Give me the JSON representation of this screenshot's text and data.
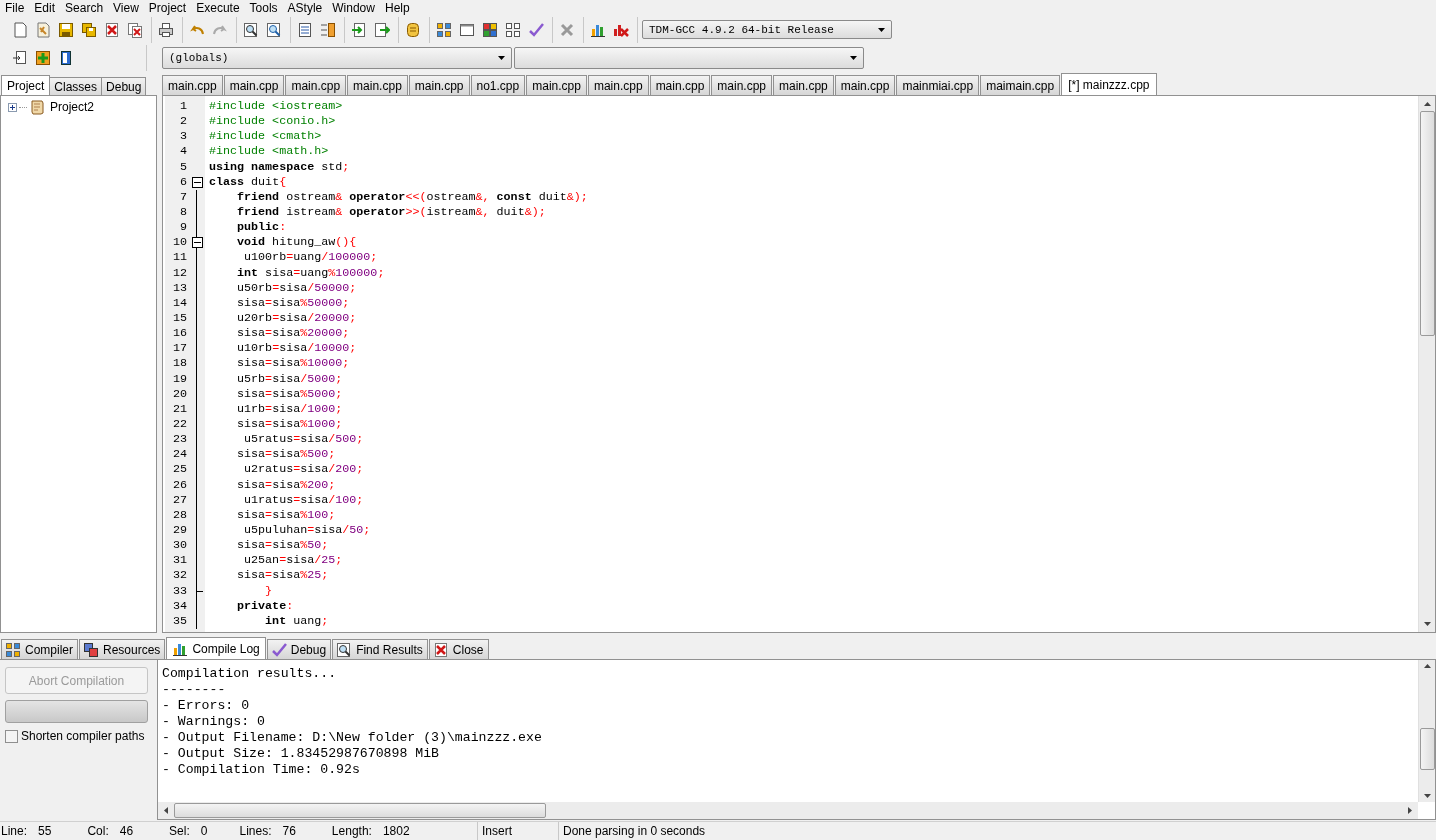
{
  "menu": [
    "File",
    "Edit",
    "Search",
    "View",
    "Project",
    "Execute",
    "Tools",
    "AStyle",
    "Window",
    "Help"
  ],
  "toolbar": {
    "compiler": "TDM-GCC 4.9.2 64-bit Release"
  },
  "scope_bar": {
    "class": "(globals)"
  },
  "side_panel": {
    "tabs": [
      {
        "label": "Project",
        "selected": true
      },
      {
        "label": "Classes",
        "selected": false
      },
      {
        "label": "Debug",
        "selected": false
      }
    ],
    "tree": [
      {
        "label": "Project2",
        "expanded": false
      }
    ]
  },
  "editor": {
    "tabs": [
      {
        "label": "main.cpp",
        "selected": false
      },
      {
        "label": "main.cpp",
        "selected": false
      },
      {
        "label": "main.cpp",
        "selected": false
      },
      {
        "label": "main.cpp",
        "selected": false
      },
      {
        "label": "main.cpp",
        "selected": false
      },
      {
        "label": "no1.cpp",
        "selected": false
      },
      {
        "label": "main.cpp",
        "selected": false
      },
      {
        "label": "main.cpp",
        "selected": false
      },
      {
        "label": "main.cpp",
        "selected": false
      },
      {
        "label": "main.cpp",
        "selected": false
      },
      {
        "label": "main.cpp",
        "selected": false
      },
      {
        "label": "main.cpp",
        "selected": false
      },
      {
        "label": "mainmiai.cpp",
        "selected": false
      },
      {
        "label": "maimain.cpp",
        "selected": false
      },
      {
        "label": "[*] mainzzz.cpp",
        "selected": true
      }
    ],
    "lines": [
      {
        "number": "1",
        "kind": "plain",
        "tokens": [
          {
            "kind": "preprocessor",
            "t": "#include <iostream>"
          }
        ]
      },
      {
        "number": "2",
        "kind": "plain",
        "tokens": [
          {
            "kind": "preprocessor",
            "t": "#include <conio.h>"
          }
        ]
      },
      {
        "number": "3",
        "kind": "plain",
        "tokens": [
          {
            "kind": "preprocessor",
            "t": "#include <cmath>"
          }
        ]
      },
      {
        "number": "4",
        "kind": "plain",
        "tokens": [
          {
            "kind": "preprocessor",
            "t": "#include <math.h>"
          }
        ]
      },
      {
        "number": "5",
        "kind": "plain",
        "tokens": [
          {
            "kind": "keyword",
            "t": "using namespace"
          },
          {
            "kind": "identifier",
            "t": " std"
          },
          {
            "kind": "symbol",
            "t": ";"
          }
        ]
      },
      {
        "number": "6",
        "kind": "fold-start",
        "tokens": [
          {
            "kind": "keyword",
            "t": "class"
          },
          {
            "kind": "identifier",
            "t": " duit"
          },
          {
            "kind": "symbol",
            "t": "{"
          }
        ]
      },
      {
        "number": "7",
        "kind": "plain",
        "tokens": [
          {
            "kind": "keyword",
            "t": "    friend"
          },
          {
            "kind": "identifier",
            "t": " ostream"
          },
          {
            "kind": "symbol",
            "t": "&"
          },
          {
            "kind": "keyword",
            "t": " operator"
          },
          {
            "kind": "symbol",
            "t": "<<("
          },
          {
            "kind": "identifier",
            "t": "ostream"
          },
          {
            "kind": "symbol",
            "t": "&,"
          },
          {
            "kind": "keyword",
            "t": " const"
          },
          {
            "kind": "identifier",
            "t": " duit"
          },
          {
            "kind": "symbol",
            "t": "&);"
          }
        ]
      },
      {
        "number": "8",
        "kind": "plain",
        "tokens": [
          {
            "kind": "keyword",
            "t": "    friend"
          },
          {
            "kind": "identifier",
            "t": " istream"
          },
          {
            "kind": "symbol",
            "t": "&"
          },
          {
            "kind": "keyword",
            "t": " operator"
          },
          {
            "kind": "symbol",
            "t": ">>("
          },
          {
            "kind": "identifier",
            "t": "istream"
          },
          {
            "kind": "symbol",
            "t": "&,"
          },
          {
            "kind": "identifier",
            "t": " duit"
          },
          {
            "kind": "symbol",
            "t": "&);"
          }
        ]
      },
      {
        "number": "9",
        "kind": "plain",
        "tokens": [
          {
            "kind": "keyword",
            "t": "    public"
          },
          {
            "kind": "symbol",
            "t": ":"
          }
        ]
      },
      {
        "number": "10",
        "kind": "fold-start",
        "tokens": [
          {
            "kind": "keyword",
            "t": "    void"
          },
          {
            "kind": "identifier",
            "t": " hitung_aw"
          },
          {
            "kind": "symbol",
            "t": "(){"
          }
        ]
      },
      {
        "number": "11",
        "kind": "plain",
        "tokens": [
          {
            "kind": "identifier",
            "t": "     u100rb"
          },
          {
            "kind": "symbol",
            "t": "="
          },
          {
            "kind": "identifier",
            "t": "uang"
          },
          {
            "kind": "symbol",
            "t": "/"
          },
          {
            "kind": "number",
            "t": "100000"
          },
          {
            "kind": "symbol",
            "t": ";"
          }
        ]
      },
      {
        "number": "12",
        "kind": "plain",
        "tokens": [
          {
            "kind": "keyword",
            "t": "    int"
          },
          {
            "kind": "identifier",
            "t": " sisa"
          },
          {
            "kind": "symbol",
            "t": "="
          },
          {
            "kind": "identifier",
            "t": "uang"
          },
          {
            "kind": "symbol",
            "t": "%"
          },
          {
            "kind": "number",
            "t": "100000"
          },
          {
            "kind": "symbol",
            "t": ";"
          }
        ]
      },
      {
        "number": "13",
        "kind": "plain",
        "tokens": [
          {
            "kind": "identifier",
            "t": "    u50rb"
          },
          {
            "kind": "symbol",
            "t": "="
          },
          {
            "kind": "identifier",
            "t": "sisa"
          },
          {
            "kind": "symbol",
            "t": "/"
          },
          {
            "kind": "number",
            "t": "50000"
          },
          {
            "kind": "symbol",
            "t": ";"
          }
        ]
      },
      {
        "number": "14",
        "kind": "plain",
        "tokens": [
          {
            "kind": "identifier",
            "t": "    sisa"
          },
          {
            "kind": "symbol",
            "t": "="
          },
          {
            "kind": "identifier",
            "t": "sisa"
          },
          {
            "kind": "symbol",
            "t": "%"
          },
          {
            "kind": "number",
            "t": "50000"
          },
          {
            "kind": "symbol",
            "t": ";"
          }
        ]
      },
      {
        "number": "15",
        "kind": "plain",
        "tokens": [
          {
            "kind": "identifier",
            "t": "    u20rb"
          },
          {
            "kind": "symbol",
            "t": "="
          },
          {
            "kind": "identifier",
            "t": "sisa"
          },
          {
            "kind": "symbol",
            "t": "/"
          },
          {
            "kind": "number",
            "t": "20000"
          },
          {
            "kind": "symbol",
            "t": ";"
          }
        ]
      },
      {
        "number": "16",
        "kind": "plain",
        "tokens": [
          {
            "kind": "identifier",
            "t": "    sisa"
          },
          {
            "kind": "symbol",
            "t": "="
          },
          {
            "kind": "identifier",
            "t": "sisa"
          },
          {
            "kind": "symbol",
            "t": "%"
          },
          {
            "kind": "number",
            "t": "20000"
          },
          {
            "kind": "symbol",
            "t": ";"
          }
        ]
      },
      {
        "number": "17",
        "kind": "plain",
        "tokens": [
          {
            "kind": "identifier",
            "t": "    u10rb"
          },
          {
            "kind": "symbol",
            "t": "="
          },
          {
            "kind": "identifier",
            "t": "sisa"
          },
          {
            "kind": "symbol",
            "t": "/"
          },
          {
            "kind": "number",
            "t": "10000"
          },
          {
            "kind": "symbol",
            "t": ";"
          }
        ]
      },
      {
        "number": "18",
        "kind": "plain",
        "tokens": [
          {
            "kind": "identifier",
            "t": "    sisa"
          },
          {
            "kind": "symbol",
            "t": "="
          },
          {
            "kind": "identifier",
            "t": "sisa"
          },
          {
            "kind": "symbol",
            "t": "%"
          },
          {
            "kind": "number",
            "t": "10000"
          },
          {
            "kind": "symbol",
            "t": ";"
          }
        ]
      },
      {
        "number": "19",
        "kind": "plain",
        "tokens": [
          {
            "kind": "identifier",
            "t": "    u5rb"
          },
          {
            "kind": "symbol",
            "t": "="
          },
          {
            "kind": "identifier",
            "t": "sisa"
          },
          {
            "kind": "symbol",
            "t": "/"
          },
          {
            "kind": "number",
            "t": "5000"
          },
          {
            "kind": "symbol",
            "t": ";"
          }
        ]
      },
      {
        "number": "20",
        "kind": "plain",
        "tokens": [
          {
            "kind": "identifier",
            "t": "    sisa"
          },
          {
            "kind": "symbol",
            "t": "="
          },
          {
            "kind": "identifier",
            "t": "sisa"
          },
          {
            "kind": "symbol",
            "t": "%"
          },
          {
            "kind": "number",
            "t": "5000"
          },
          {
            "kind": "symbol",
            "t": ";"
          }
        ]
      },
      {
        "number": "21",
        "kind": "plain",
        "tokens": [
          {
            "kind": "identifier",
            "t": "    u1rb"
          },
          {
            "kind": "symbol",
            "t": "="
          },
          {
            "kind": "identifier",
            "t": "sisa"
          },
          {
            "kind": "symbol",
            "t": "/"
          },
          {
            "kind": "number",
            "t": "1000"
          },
          {
            "kind": "symbol",
            "t": ";"
          }
        ]
      },
      {
        "number": "22",
        "kind": "plain",
        "tokens": [
          {
            "kind": "identifier",
            "t": "    sisa"
          },
          {
            "kind": "symbol",
            "t": "="
          },
          {
            "kind": "identifier",
            "t": "sisa"
          },
          {
            "kind": "symbol",
            "t": "%"
          },
          {
            "kind": "number",
            "t": "1000"
          },
          {
            "kind": "symbol",
            "t": ";"
          }
        ]
      },
      {
        "number": "23",
        "kind": "plain",
        "tokens": [
          {
            "kind": "identifier",
            "t": "     u5ratus"
          },
          {
            "kind": "symbol",
            "t": "="
          },
          {
            "kind": "identifier",
            "t": "sisa"
          },
          {
            "kind": "symbol",
            "t": "/"
          },
          {
            "kind": "number",
            "t": "500"
          },
          {
            "kind": "symbol",
            "t": ";"
          }
        ]
      },
      {
        "number": "24",
        "kind": "plain",
        "tokens": [
          {
            "kind": "identifier",
            "t": "    sisa"
          },
          {
            "kind": "symbol",
            "t": "="
          },
          {
            "kind": "identifier",
            "t": "sisa"
          },
          {
            "kind": "symbol",
            "t": "%"
          },
          {
            "kind": "number",
            "t": "500"
          },
          {
            "kind": "symbol",
            "t": ";"
          }
        ]
      },
      {
        "number": "25",
        "kind": "plain",
        "tokens": [
          {
            "kind": "identifier",
            "t": "     u2ratus"
          },
          {
            "kind": "symbol",
            "t": "="
          },
          {
            "kind": "identifier",
            "t": "sisa"
          },
          {
            "kind": "symbol",
            "t": "/"
          },
          {
            "kind": "number",
            "t": "200"
          },
          {
            "kind": "symbol",
            "t": ";"
          }
        ]
      },
      {
        "number": "26",
        "kind": "plain",
        "tokens": [
          {
            "kind": "identifier",
            "t": "    sisa"
          },
          {
            "kind": "symbol",
            "t": "="
          },
          {
            "kind": "identifier",
            "t": "sisa"
          },
          {
            "kind": "symbol",
            "t": "%"
          },
          {
            "kind": "number",
            "t": "200"
          },
          {
            "kind": "symbol",
            "t": ";"
          }
        ]
      },
      {
        "number": "27",
        "kind": "plain",
        "tokens": [
          {
            "kind": "identifier",
            "t": "     u1ratus"
          },
          {
            "kind": "symbol",
            "t": "="
          },
          {
            "kind": "identifier",
            "t": "sisa"
          },
          {
            "kind": "symbol",
            "t": "/"
          },
          {
            "kind": "number",
            "t": "100"
          },
          {
            "kind": "symbol",
            "t": ";"
          }
        ]
      },
      {
        "number": "28",
        "kind": "plain",
        "tokens": [
          {
            "kind": "identifier",
            "t": "    sisa"
          },
          {
            "kind": "symbol",
            "t": "="
          },
          {
            "kind": "identifier",
            "t": "sisa"
          },
          {
            "kind": "symbol",
            "t": "%"
          },
          {
            "kind": "number",
            "t": "100"
          },
          {
            "kind": "symbol",
            "t": ";"
          }
        ]
      },
      {
        "number": "29",
        "kind": "plain",
        "tokens": [
          {
            "kind": "identifier",
            "t": "     u5puluhan"
          },
          {
            "kind": "symbol",
            "t": "="
          },
          {
            "kind": "identifier",
            "t": "sisa"
          },
          {
            "kind": "symbol",
            "t": "/"
          },
          {
            "kind": "number",
            "t": "50"
          },
          {
            "kind": "symbol",
            "t": ";"
          }
        ]
      },
      {
        "number": "30",
        "kind": "plain",
        "tokens": [
          {
            "kind": "identifier",
            "t": "    sisa"
          },
          {
            "kind": "symbol",
            "t": "="
          },
          {
            "kind": "identifier",
            "t": "sisa"
          },
          {
            "kind": "symbol",
            "t": "%"
          },
          {
            "kind": "number",
            "t": "50"
          },
          {
            "kind": "symbol",
            "t": ";"
          }
        ]
      },
      {
        "number": "31",
        "kind": "plain",
        "tokens": [
          {
            "kind": "identifier",
            "t": "     u25an"
          },
          {
            "kind": "symbol",
            "t": "="
          },
          {
            "kind": "identifier",
            "t": "sisa"
          },
          {
            "kind": "symbol",
            "t": "/"
          },
          {
            "kind": "number",
            "t": "25"
          },
          {
            "kind": "symbol",
            "t": ";"
          }
        ]
      },
      {
        "number": "32",
        "kind": "plain",
        "tokens": [
          {
            "kind": "identifier",
            "t": "    sisa"
          },
          {
            "kind": "symbol",
            "t": "="
          },
          {
            "kind": "identifier",
            "t": "sisa"
          },
          {
            "kind": "symbol",
            "t": "%"
          },
          {
            "kind": "number",
            "t": "25"
          },
          {
            "kind": "symbol",
            "t": ";"
          }
        ]
      },
      {
        "number": "33",
        "kind": "fold-end",
        "tokens": [
          {
            "kind": "symbol",
            "t": "        }"
          }
        ]
      },
      {
        "number": "34",
        "kind": "plain",
        "tokens": [
          {
            "kind": "keyword",
            "t": "    private"
          },
          {
            "kind": "symbol",
            "t": ":"
          }
        ]
      },
      {
        "number": "35",
        "kind": "plain",
        "tokens": [
          {
            "kind": "keyword",
            "t": "        int"
          },
          {
            "kind": "identifier",
            "t": " uang"
          },
          {
            "kind": "symbol",
            "t": ";"
          }
        ]
      }
    ]
  },
  "bottom_panel": {
    "tabs": [
      {
        "label": "Compiler",
        "selected": false
      },
      {
        "label": "Resources",
        "selected": false
      },
      {
        "label": "Compile Log",
        "selected": true
      },
      {
        "label": "Debug",
        "selected": false
      },
      {
        "label": "Find Results",
        "selected": false
      },
      {
        "label": "Close",
        "selected": false
      }
    ],
    "abort_button": {
      "label": "Abort Compilation",
      "disabled": true
    },
    "progress": {
      "level": 0
    },
    "shorten_paths": {
      "label": "Shorten compiler paths",
      "checked": false
    },
    "log": [
      "Compilation results...",
      "--------",
      "- Errors: 0",
      "- Warnings: 0",
      "- Output Filename: D:\\New folder (3)\\mainzzz.exe",
      "- Output Size: 1.83452987670898 MiB",
      "- Compilation Time: 0.92s"
    ]
  },
  "status_bar": {
    "fields": [
      {
        "label": "Line:",
        "value": "55"
      },
      {
        "label": "Col:",
        "value": "46"
      },
      {
        "label": "Sel:",
        "value": "0"
      },
      {
        "label": "Lines:",
        "value": "76"
      },
      {
        "label": "Length:",
        "value": "1802"
      }
    ],
    "mode": "Insert",
    "message": "Done parsing in 0 seconds"
  }
}
